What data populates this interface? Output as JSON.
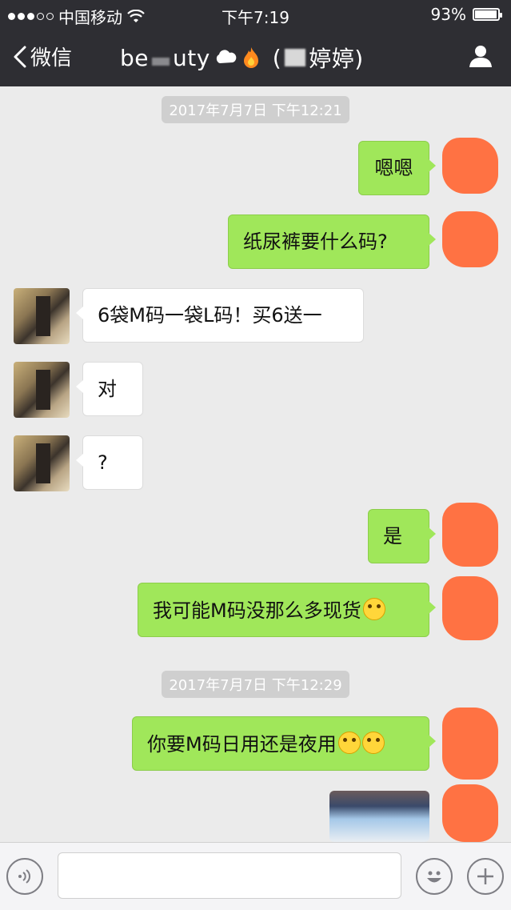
{
  "status": {
    "carrier": "中国移动",
    "time": "下午7:19",
    "battery": "93%"
  },
  "nav": {
    "back_label": "微信",
    "title_prefix": "be",
    "title_mid": "uty",
    "title_suffix": "婷婷)",
    "title_paren": "("
  },
  "timestamps": [
    "2017年7月7日 下午12:21",
    "2017年7月7日 下午12:29"
  ],
  "messages": [
    {
      "side": "out",
      "text": "嗯嗯"
    },
    {
      "side": "out",
      "text": "纸尿裤要什么码?"
    },
    {
      "side": "in",
      "text": "6袋M码一袋L码！买6送一"
    },
    {
      "side": "in",
      "text": "对"
    },
    {
      "side": "in",
      "text": "?"
    },
    {
      "side": "out",
      "text": "是"
    },
    {
      "side": "out",
      "text_pre": "我",
      "text": "可能M码没那么多现货"
    },
    {
      "side": "out",
      "text": "你要M码日用还是夜用"
    }
  ],
  "icons": {
    "back": "chevron-left-icon",
    "profile": "person-icon",
    "voice": "voice-icon",
    "emoji": "smiley-icon",
    "plus": "plus-icon",
    "wifi": "wifi-icon",
    "battery": "battery-icon"
  }
}
